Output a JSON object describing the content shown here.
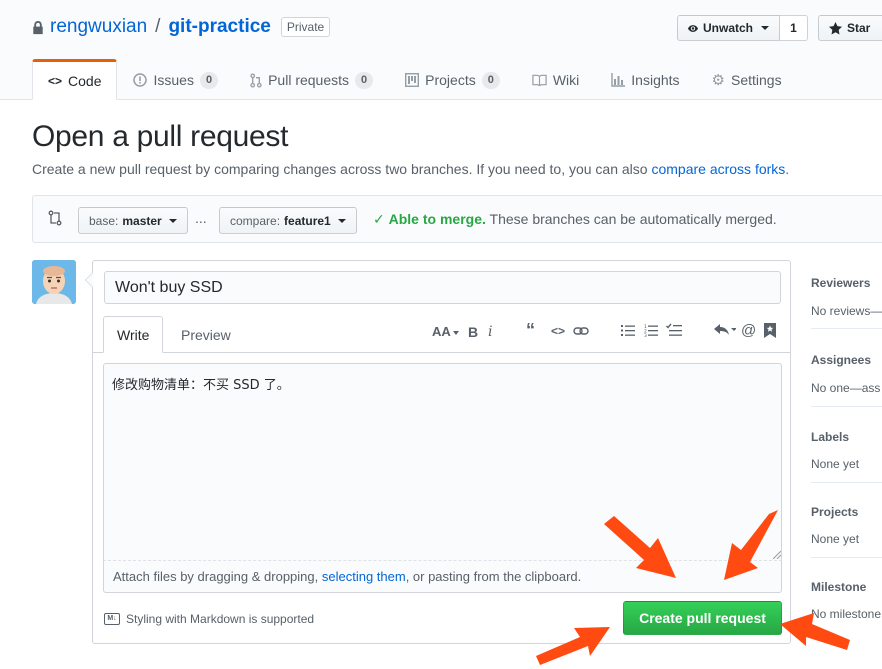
{
  "repo": {
    "owner": "rengwuxian",
    "separator": "/",
    "name": "git-practice",
    "visibility": "Private",
    "watch_label": "Unwatch",
    "watch_count": "1",
    "star_label": "Star"
  },
  "tabs": [
    {
      "label": "Code",
      "icon": "code-icon",
      "counter": null
    },
    {
      "label": "Issues",
      "icon": "issue-icon",
      "counter": "0"
    },
    {
      "label": "Pull requests",
      "icon": "pull-request-icon",
      "counter": "0"
    },
    {
      "label": "Projects",
      "icon": "project-icon",
      "counter": "0"
    },
    {
      "label": "Wiki",
      "icon": "book-icon",
      "counter": null
    },
    {
      "label": "Insights",
      "icon": "graph-icon",
      "counter": null
    },
    {
      "label": "Settings",
      "icon": "gear-icon",
      "counter": null
    }
  ],
  "page": {
    "title": "Open a pull request",
    "subtitle_text": "Create a new pull request by comparing changes across two branches. If you need to, you can also ",
    "subtitle_link": "compare across forks",
    "subtitle_end": "."
  },
  "range": {
    "base_label": "base:",
    "base_branch": "master",
    "ellipsis": "...",
    "compare_label": "compare:",
    "compare_branch": "feature1",
    "merge_status": "Able to merge.",
    "merge_message": "These branches can be automatically merged."
  },
  "composer": {
    "title_value": "Won't buy SSD",
    "write_tab": "Write",
    "preview_tab": "Preview",
    "body_value": "修改购物清单：不买 SSD 了。",
    "attach_text_before": "Attach files by dragging & dropping, ",
    "attach_link": "selecting them",
    "attach_text_after": ", or pasting from the clipboard.",
    "markdown_note": "Styling with Markdown is supported",
    "submit_label": "Create pull request",
    "toolbar": [
      "header-icon",
      "bold-icon",
      "italic-icon",
      "quote-icon",
      "code-icon",
      "link-icon",
      "unordered-list-icon",
      "ordered-list-icon",
      "task-list-icon",
      "reply-icon",
      "mention-icon",
      "bookmark-icon"
    ]
  },
  "sidebar": {
    "reviewers_title": "Reviewers",
    "reviewers_value": "No reviews—",
    "assignees_title": "Assignees",
    "assignees_value": "No one—ass",
    "labels_title": "Labels",
    "labels_value": "None yet",
    "projects_title": "Projects",
    "projects_value": "None yet",
    "milestone_title": "Milestone",
    "milestone_value": "No milestone"
  },
  "colors": {
    "link": "#0366d6",
    "success": "#28a745",
    "selected_tab_accent": "#e36209",
    "annotation_arrows": "#ff4a12"
  }
}
